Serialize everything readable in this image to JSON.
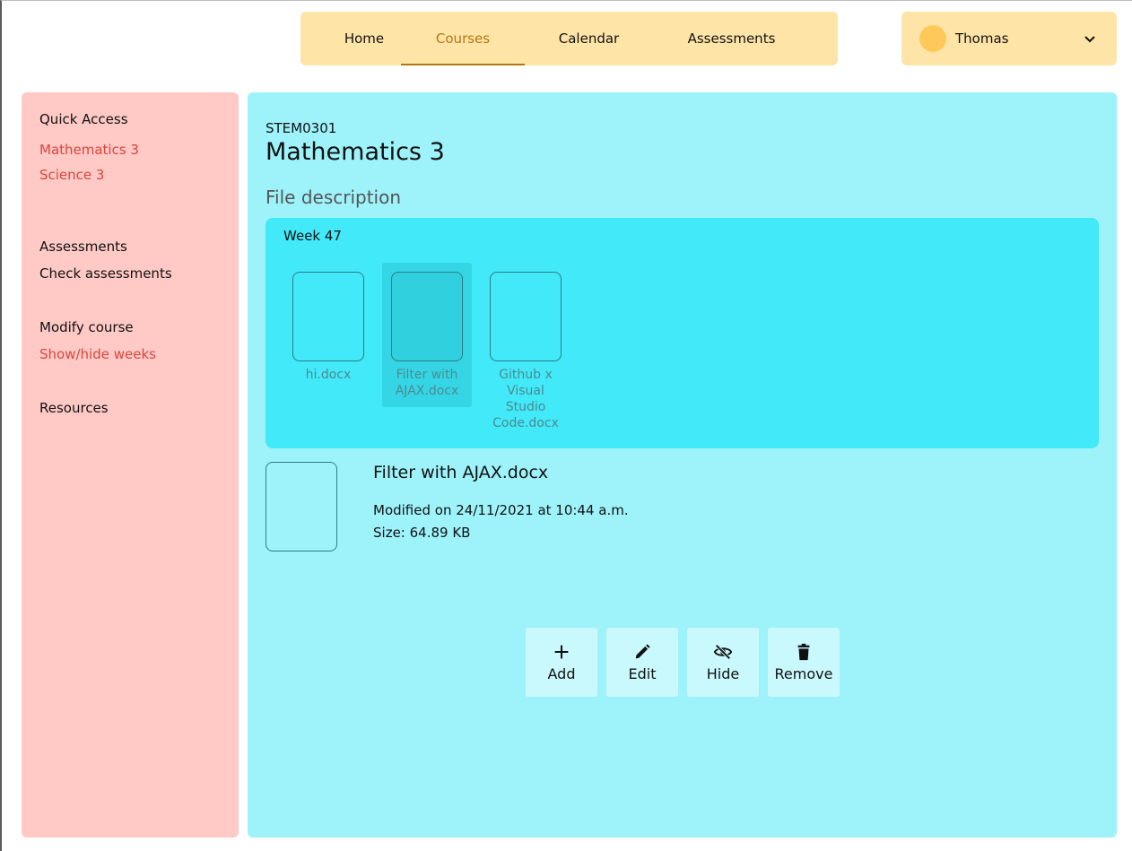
{
  "nav": {
    "tabs": [
      {
        "label": "Home"
      },
      {
        "label": "Courses"
      },
      {
        "label": "Calendar"
      },
      {
        "label": "Assessments"
      }
    ],
    "active_tab": "Courses"
  },
  "user": {
    "name": "Thomas"
  },
  "sidebar": {
    "quick_access_heading": "Quick Access",
    "quick_links": [
      "Mathematics 3",
      "Science 3"
    ],
    "assessments_heading": "Assessments",
    "check_assessments": "Check assessments",
    "modify_heading": "Modify course",
    "show_hide_weeks": "Show/hide weeks",
    "resources": "Resources"
  },
  "course": {
    "code": "STEM0301",
    "title": "Mathematics 3",
    "file_description_label": "File description"
  },
  "week": {
    "title": "Week 47",
    "files": [
      {
        "name": "hi.docx"
      },
      {
        "name": "Filter with AJAX.docx"
      },
      {
        "name": "Github x Visual Studio Code.docx"
      }
    ],
    "selected_index": 1
  },
  "selected_file": {
    "name": "Filter with AJAX.docx",
    "modified": "Modified on 24/11/2021 at 10:44 a.m.",
    "size": "Size: 64.89 KB"
  },
  "actions": {
    "add": "Add",
    "edit": "Edit",
    "hide": "Hide",
    "remove": "Remove"
  },
  "colors": {
    "nav_bg": "#ffe4a8",
    "accent": "#b3780f",
    "sidebar_bg": "#ffc9c5",
    "sidebar_link": "#d9463e",
    "main_bg": "#9ef3fb",
    "week_bg": "#42e9f8"
  }
}
